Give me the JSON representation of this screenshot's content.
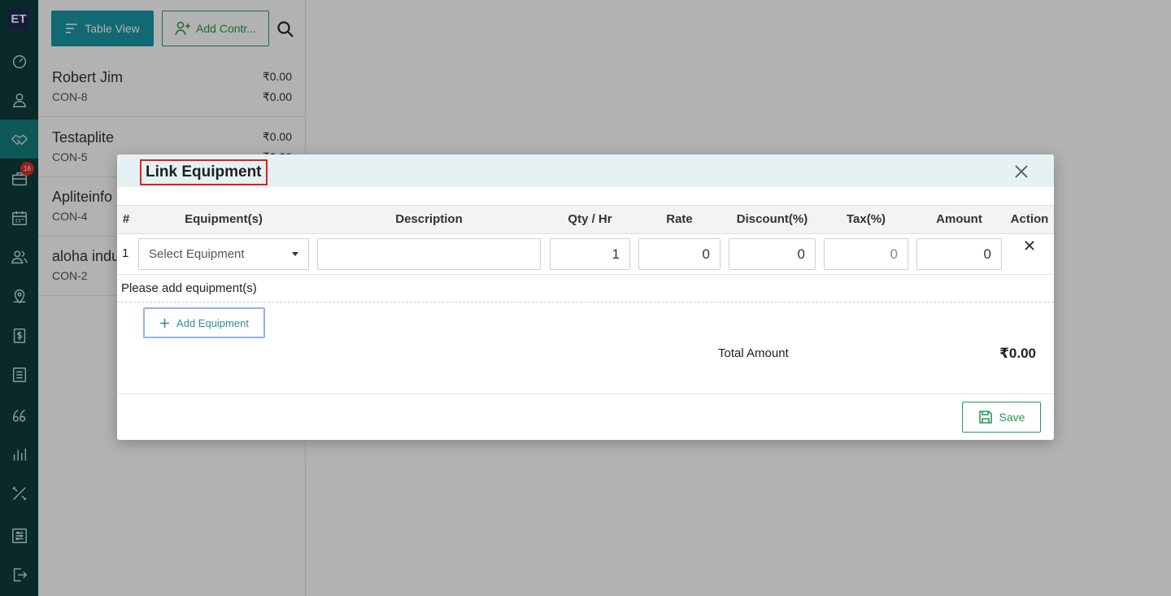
{
  "app": {
    "logo": "ET"
  },
  "rail": {
    "items": [
      {
        "icon": "dashboard-icon"
      },
      {
        "icon": "person-icon"
      },
      {
        "icon": "handshake-icon",
        "active": true
      },
      {
        "icon": "briefcase-icon",
        "badge": "16"
      },
      {
        "icon": "calendar-icon"
      },
      {
        "icon": "users-icon"
      },
      {
        "icon": "map-pin-icon"
      },
      {
        "icon": "dollar-icon"
      },
      {
        "icon": "list-icon"
      },
      {
        "icon": "quote-icon"
      },
      {
        "icon": "bar-chart-icon"
      },
      {
        "icon": "tools-icon"
      },
      {
        "icon": "sliders-icon"
      },
      {
        "icon": "logout-icon"
      }
    ]
  },
  "toolbar": {
    "table_view_label": "Table View",
    "add_contract_label": "Add Contr..."
  },
  "contacts": [
    {
      "name": "Robert Jim",
      "code": "CON-8",
      "amount1": "₹0.00",
      "amount2": "₹0.00"
    },
    {
      "name": "Testaplite",
      "code": "CON-5",
      "amount1": "₹0.00",
      "amount2": "₹0.00"
    },
    {
      "name": "Apliteinfo",
      "code": "CON-4",
      "amount1": "",
      "amount2": ""
    },
    {
      "name": "aloha indu",
      "code": "CON-2",
      "amount1": "",
      "amount2": ""
    }
  ],
  "modal": {
    "title": "Link Equipment",
    "columns": [
      "#",
      "Equipment(s)",
      "Description",
      "Qty / Hr",
      "Rate",
      "Discount(%)",
      "Tax(%)",
      "Amount",
      "Action"
    ],
    "row": {
      "num": "1",
      "equipment_placeholder": "Select Equipment",
      "description": "",
      "qty": "1",
      "rate": "0",
      "discount": "0",
      "tax": "0",
      "amount": "0"
    },
    "message": "Please add equipment(s)",
    "add_equipment_label": "Add Equipment",
    "total_label": "Total Amount",
    "total_value": "₹0.00",
    "save_label": "Save"
  },
  "colors": {
    "rail": "#0f3c3c",
    "active": "#15807e",
    "primary": "#1897a5",
    "success": "#2a9a4f",
    "highlight": "#e21e1e"
  }
}
